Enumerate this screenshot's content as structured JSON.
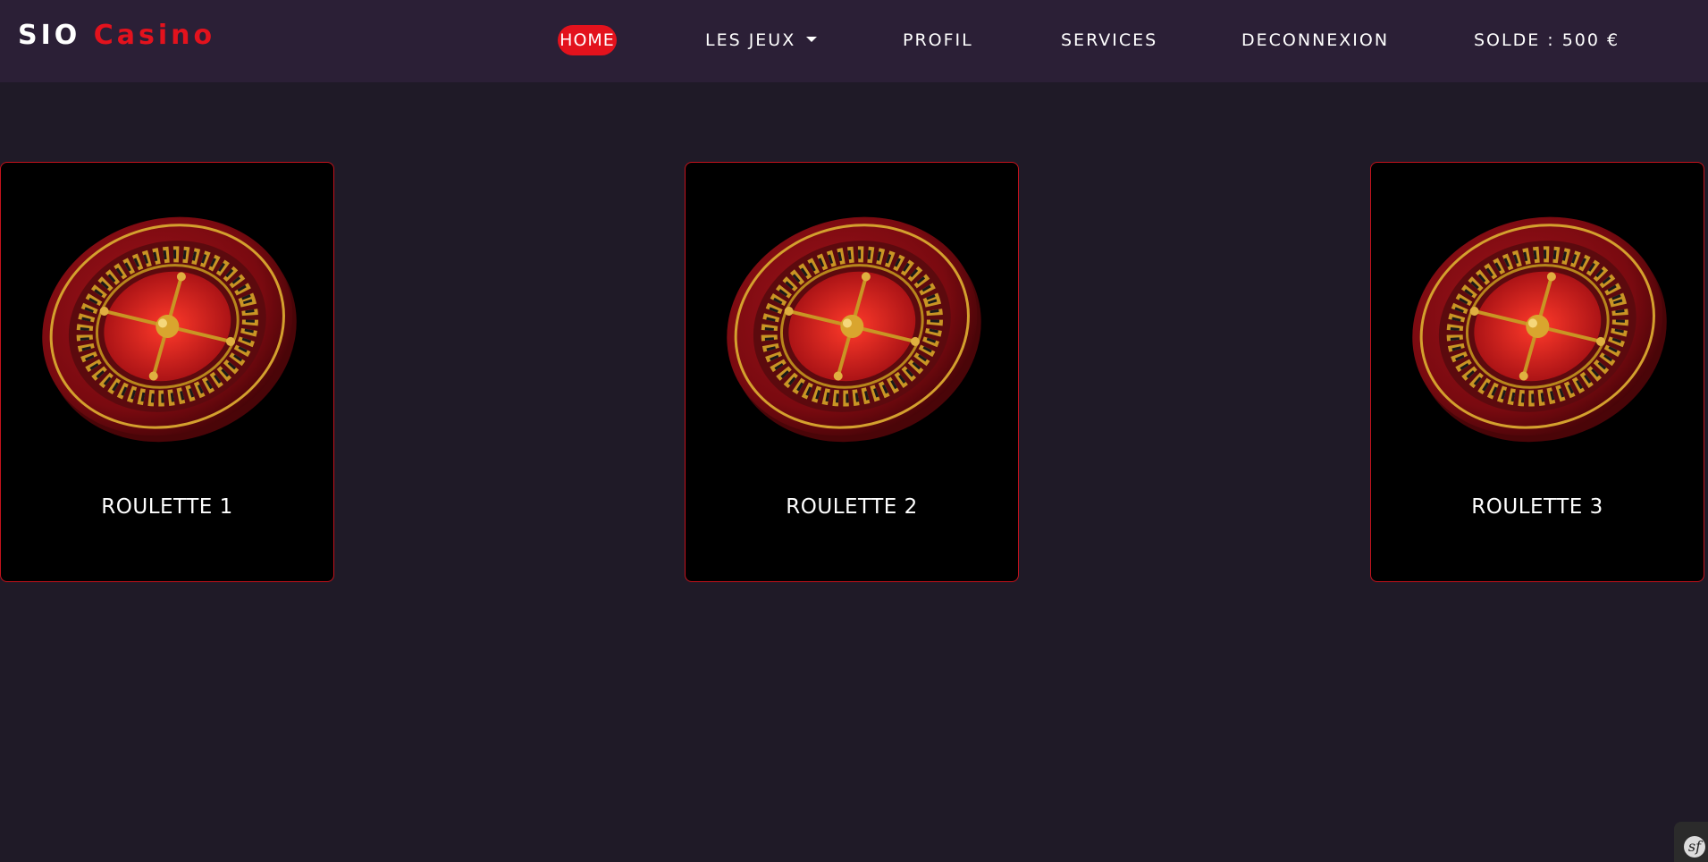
{
  "brand": {
    "prefix": "SIO",
    "name": "Casino"
  },
  "nav": {
    "home": "HOME",
    "games": "LES JEUX",
    "profile": "PROFIL",
    "services": "SERVICES",
    "logout": "DECONNEXION",
    "balance": "SOLDE : 500 €"
  },
  "games": [
    {
      "title": "ROULETTE 1"
    },
    {
      "title": "ROULETTE 2"
    },
    {
      "title": "ROULETTE 3"
    }
  ],
  "toolbar": {
    "symbol": "sf"
  },
  "colors": {
    "background": "#1f1a27",
    "navbar": "#2b1f36",
    "accent": "#e3121d",
    "card": "#000000"
  },
  "icons": {
    "dropdown": "chevron-down-icon",
    "wheel": "roulette-wheel-icon",
    "debug": "symfony-icon"
  }
}
